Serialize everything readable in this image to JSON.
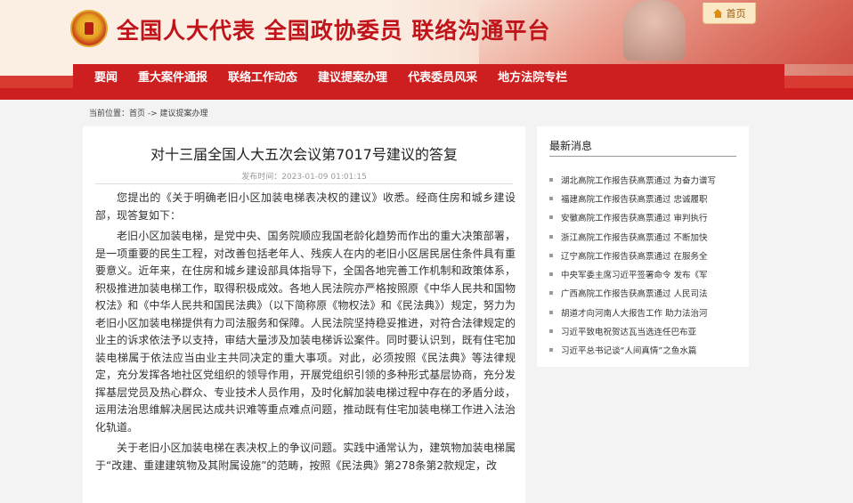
{
  "header": {
    "site_title": "全国人大代表 全国政协委员 联络沟通平台",
    "home_label": "首页"
  },
  "nav": {
    "items": [
      "要闻",
      "重大案件通报",
      "联络工作动态",
      "建议提案办理",
      "代表委员风采",
      "地方法院专栏"
    ]
  },
  "breadcrumb": {
    "text": "当前位置：首页  -> 建议提案办理"
  },
  "article": {
    "title": "对十三届全国人大五次会议第7017号建议的答复",
    "meta": "发布时间：2023-01-09 01:01:15",
    "paragraphs": [
      "您提出的《关于明确老旧小区加装电梯表决权的建议》收悉。经商住房和城乡建设部，现答复如下：",
      "老旧小区加装电梯，是党中央、国务院顺应我国老龄化趋势而作出的重大决策部署，是一项重要的民生工程，对改善包括老年人、残疾人在内的老旧小区居民居住条件具有重要意义。近年来，在住房和城乡建设部具体指导下，全国各地完善工作机制和政策体系，积极推进加装电梯工作，取得积极成效。各地人民法院亦严格按照原《中华人民共和国物权法》和《中华人民共和国民法典》（以下简称原《物权法》和《民法典》）规定，努力为老旧小区加装电梯提供有力司法服务和保障。人民法院坚持稳妥推进，对符合法律规定的业主的诉求依法予以支持，审结大量涉及加装电梯诉讼案件。同时要认识到，既有住宅加装电梯属于依法应当由业主共同决定的重大事项。对此，必须按照《民法典》等法律规定，充分发挥各地社区党组织的领导作用，开展党组织引领的多种形式基层协商，充分发挥基层党员及热心群众、专业技术人员作用，及时化解加装电梯过程中存在的矛盾分歧，运用法治思维解决居民达成共识难等重点难点问题，推动既有住宅加装电梯工作进入法治化轨道。",
      "关于老旧小区加装电梯在表决权上的争议问题。实践中通常认为，建筑物加装电梯属于“改建、重建建筑物及其附属设施”的范畴，按照《民法典》第278条第2款规定，改"
    ]
  },
  "sidebar": {
    "title": "最新消息",
    "items": [
      "湖北高院工作报告获高票通过 为奋力谱写",
      "福建高院工作报告获高票通过 忠诚履职",
      "安徽高院工作报告获高票通过 审判执行",
      "浙江高院工作报告获高票通过 不断加快",
      "辽宁高院工作报告获高票通过 在服务全",
      "中央军委主席习近平签署命令 发布《军",
      "广西高院工作报告获高票通过 人民司法",
      "胡道才向河南人大报告工作 助力法治河",
      "习近平致电祝贺达瓦当选连任巴布亚",
      "习近平总书记谈“人间真情”之鱼水篇"
    ]
  }
}
